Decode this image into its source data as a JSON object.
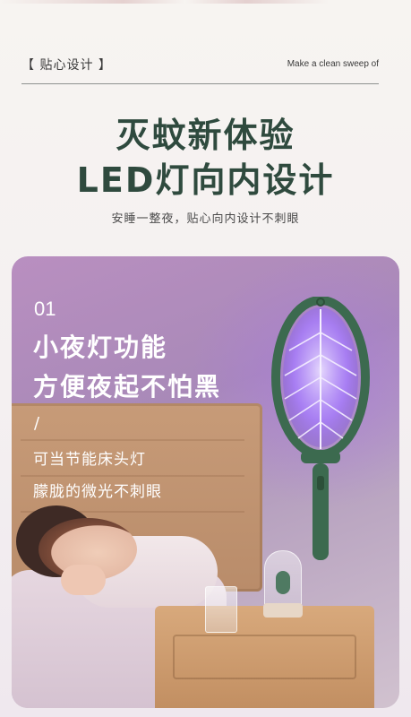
{
  "header": {
    "tag": "【 贴心设计 】",
    "tagline": "Make a clean sweep of"
  },
  "hero": {
    "title_line1": "灭蚊新体验",
    "title_line2": "LED灯向内设计",
    "subtitle": "安睡一整夜，贴心向内设计不刺眼"
  },
  "feature": {
    "number": "01",
    "heading_line1": "小夜灯功能",
    "heading_line2": "方便夜起不怕黑",
    "divider": "/",
    "desc_line1": "可当节能床头灯",
    "desc_line2": "朦胧的微光不刺眼"
  },
  "colors": {
    "title": "#2f4a3e",
    "swatter_frame": "#3c6a4f",
    "glow": "#a67bff"
  },
  "icons": {
    "swatter": "mosquito-swatter-icon"
  }
}
